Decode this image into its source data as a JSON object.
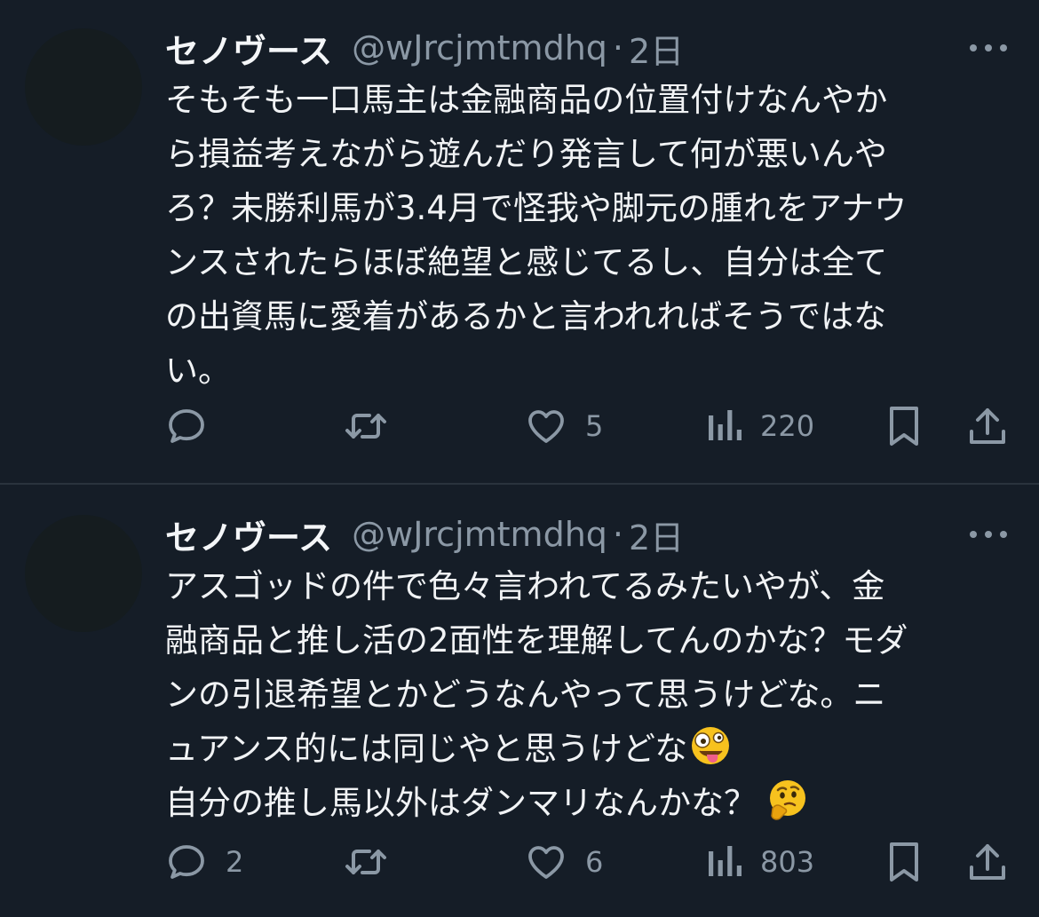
{
  "tweets": [
    {
      "display_name": "セノヴース",
      "handle": "@wJrcjmtmdhq",
      "separator": "·",
      "time": "2日",
      "lines": [
        "そもそも一口馬主は金融商品の位置付けなんやか",
        "ら損益考えながら遊んだり発言して何が悪いんや",
        "ろ？未勝利馬が3.4月で怪我や脚元の腫れをアナウ",
        "ンスされたらほぼ絶望と感じてるし、自分は全て",
        "の出資馬に愛着があるかと言われればそうではな",
        "い。"
      ],
      "actions": {
        "reply_count": "",
        "retweet_count": "",
        "like_count": "5",
        "views_count": "220"
      }
    },
    {
      "display_name": "セノヴース",
      "handle": "@wJrcjmtmdhq",
      "separator": "·",
      "time": "2日",
      "lines": [
        "アスゴッドの件で色々言われてるみたいやが、金",
        "融商品と推し活の2面性を理解してんのかな？モダ",
        "ンの引退希望とかどうなんやって思うけどな。ニ",
        "ュアンス的には同じやと思うけどな",
        "自分の推し馬以外はダンマリなんかな？"
      ],
      "emojis": {
        "line4": "zany-face-emoji",
        "line5": "thinking-face-emoji"
      },
      "actions": {
        "reply_count": "2",
        "retweet_count": "",
        "like_count": "6",
        "views_count": "803"
      }
    }
  ],
  "colors": {
    "background": "#151d27",
    "text": "#f1f3f5",
    "secondary_text": "#8b98a5",
    "divider": "#2a333d",
    "avatar": "#151c1f"
  },
  "icons": [
    "reply-icon",
    "retweet-icon",
    "like-icon",
    "views-icon",
    "bookmark-icon",
    "share-icon",
    "more-icon"
  ]
}
